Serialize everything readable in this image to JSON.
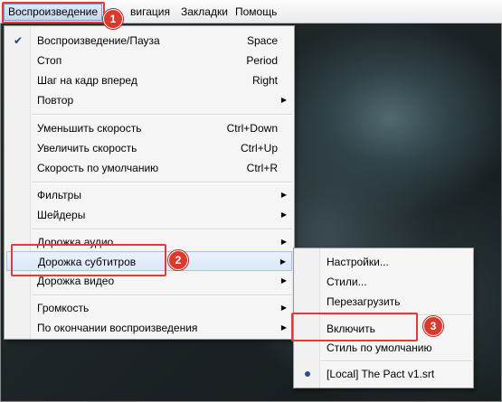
{
  "menubar": {
    "items": [
      "Воспроизведение",
      "вигация",
      "Закладки",
      "Помощь"
    ]
  },
  "main_menu": {
    "items": [
      {
        "label": "Воспроизведение/Пауза",
        "shortcut": "Space",
        "checked": true
      },
      {
        "label": "Стоп",
        "shortcut": "Period"
      },
      {
        "label": "Шаг на кадр вперед",
        "shortcut": "Right"
      },
      {
        "label": "Повтор",
        "submenu": true
      },
      {
        "label": "Уменьшить скорость",
        "shortcut": "Ctrl+Down"
      },
      {
        "label": "Увеличить скорость",
        "shortcut": "Ctrl+Up"
      },
      {
        "label": "Скорость по умолчанию",
        "shortcut": "Ctrl+R"
      },
      {
        "label": "Фильтры",
        "submenu": true
      },
      {
        "label": "Шейдеры",
        "submenu": true
      },
      {
        "label": "Дорожка аудио",
        "submenu": true
      },
      {
        "label": "Дорожка субтитров",
        "submenu": true
      },
      {
        "label": "Дорожка видео",
        "submenu": true
      },
      {
        "label": "Громкость",
        "submenu": true
      },
      {
        "label": "По окончании воспроизведения",
        "submenu": true
      }
    ]
  },
  "sub_menu": {
    "items": [
      {
        "label": "Настройки..."
      },
      {
        "label": "Стили..."
      },
      {
        "label": "Перезагрузить"
      },
      {
        "label": "Включить"
      },
      {
        "label": "Стиль по умолчанию"
      },
      {
        "label": "[Local] The Pact v1.srt",
        "selected": true
      }
    ]
  },
  "badges": {
    "one": "1",
    "two": "2",
    "three": "3"
  },
  "colors": {
    "annotation_red": "#d83a2e",
    "checkmark": "#1d3f8f"
  }
}
